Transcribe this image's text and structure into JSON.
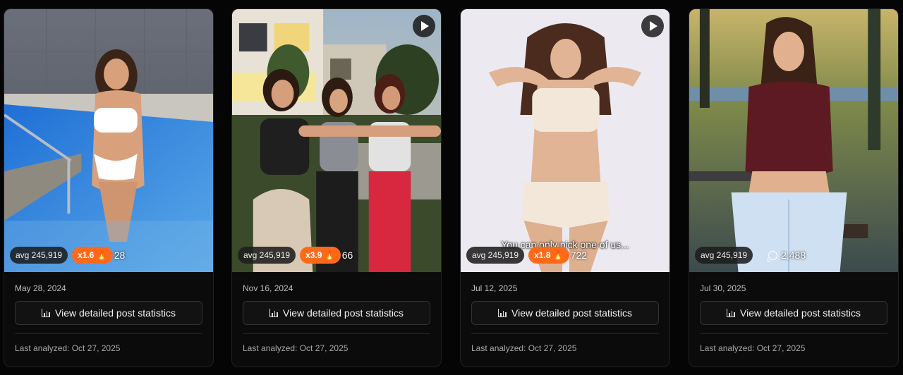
{
  "cards": [
    {
      "avg_label": "avg 245,919",
      "multiplier_label": "x1.6 🔥",
      "comments_partial": "28",
      "date": "May 28, 2024",
      "button_label": "View detailed post statistics",
      "analyzed": "Last analyzed: Oct 27, 2025"
    },
    {
      "avg_label": "avg 245,919",
      "multiplier_label": "x3.9 🔥",
      "comments_partial": "66",
      "date": "Nov 16, 2024",
      "button_label": "View detailed post statistics",
      "analyzed": "Last analyzed: Oct 27, 2025"
    },
    {
      "avg_label": "avg 245,919",
      "multiplier_label": "x1.8 🔥",
      "comments_partial": "722",
      "caption": "You can only pick one of us...",
      "date": "Jul 12, 2025",
      "button_label": "View detailed post statistics",
      "analyzed": "Last analyzed: Oct 27, 2025"
    },
    {
      "avg_label": "avg 245,919",
      "comments": "2,488",
      "date": "Jul 30, 2025",
      "button_label": "View detailed post statistics",
      "analyzed": "Last analyzed: Oct 27, 2025"
    }
  ],
  "icons": {
    "play": "play-icon",
    "comment": "comment-icon",
    "stats": "bar-chart-icon"
  },
  "colors": {
    "multiplier_badge": "#ff6a1a",
    "page_background": "#050505",
    "card_background": "#0b0b0b"
  }
}
